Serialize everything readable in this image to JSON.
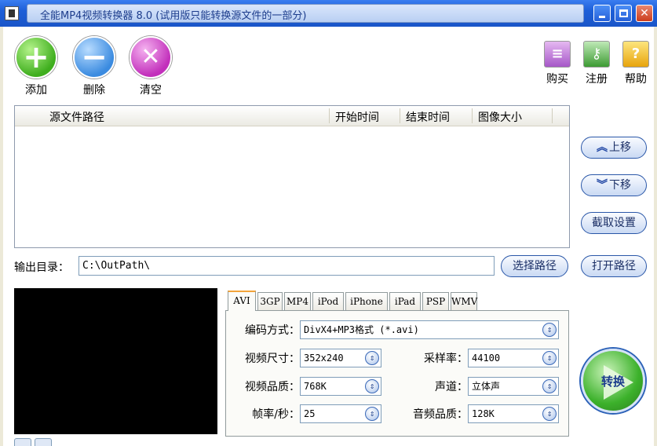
{
  "window": {
    "title": "全能MP4视频转换器 8.0 (试用版只能转换源文件的一部分)"
  },
  "toolbar": {
    "add_label": "添加",
    "delete_label": "删除",
    "clear_label": "清空"
  },
  "side_toolbar": {
    "buy_label": "购买",
    "register_label": "注册",
    "help_label": "帮助"
  },
  "file_list": {
    "columns": [
      "源文件路径",
      "开始时间",
      "结束时间",
      "图像大小"
    ],
    "rows": []
  },
  "side_buttons": {
    "move_up": "上移",
    "move_down": "下移",
    "capture_settings": "截取设置",
    "open_path": "打开路径"
  },
  "output": {
    "label": "输出目录：",
    "path": "C:\\OutPath\\",
    "browse_label": "选择路径"
  },
  "tabs": [
    "AVI",
    "3GP",
    "MP4",
    "iPod",
    "iPhone",
    "iPad",
    "PSP",
    "WMV"
  ],
  "settings": {
    "encoding_label": "编码方式：",
    "encoding_value": "DivX4+MP3格式 (*.avi)",
    "video_size_label": "视频尺寸：",
    "video_size_value": "352x240",
    "video_quality_label": "视频品质：",
    "video_quality_value": "768K",
    "framerate_label": "帧率/秒：",
    "framerate_value": "25",
    "sample_rate_label": "采样率：",
    "sample_rate_value": "44100",
    "channel_label": "声道：",
    "channel_value": "立体声",
    "audio_quality_label": "音频品质：",
    "audio_quality_value": "128K"
  },
  "convert_label": "转换",
  "colors": {
    "titlebar": "#1d5fd8",
    "accent_blue": "#2a57a8",
    "convert_green": "#3cb12b"
  }
}
